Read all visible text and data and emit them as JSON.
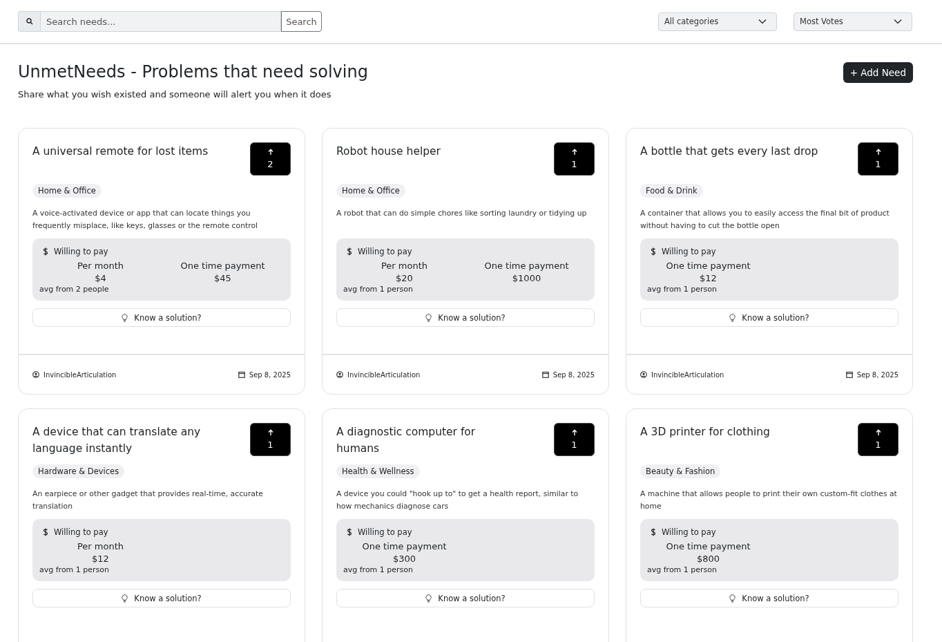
{
  "search": {
    "placeholder": "Search needs...",
    "button": "Search"
  },
  "filters": [
    {
      "value": "All categories"
    },
    {
      "value": "Most Votes"
    }
  ],
  "title": "UnmetNeeds - Problems that need solving",
  "subtitle": "Share what you wish existed and someone will alert you when it does",
  "add_button": "+ Add Need",
  "needs": [
    {
      "title": "A universal remote for lost items",
      "votes": "2",
      "category": "Home & Office",
      "description": "A voice-activated device or app that can locate things you frequently misplace, like keys, glasses or the remote control",
      "pay_label": "Willing to pay",
      "payments": [
        {
          "label": "Per month",
          "amount": "$4"
        },
        {
          "label": "One time payment",
          "amount": "$45"
        }
      ],
      "avg": "avg from 2 people",
      "solution": "Know a solution?",
      "author": "InvincibleArticulation",
      "date": "Sep 8, 2025"
    },
    {
      "title": "Robot house helper",
      "votes": "1",
      "category": "Home & Office",
      "description": "A robot that can do simple chores like sorting laundry or tidying up",
      "pay_label": "Willing to pay",
      "payments": [
        {
          "label": "Per month",
          "amount": "$20"
        },
        {
          "label": "One time payment",
          "amount": "$1000"
        }
      ],
      "avg": "avg from 1 person",
      "solution": "Know a solution?",
      "author": "InvincibleArticulation",
      "date": "Sep 8, 2025"
    },
    {
      "title": "A bottle that gets every last drop",
      "votes": "1",
      "category": "Food & Drink",
      "description": "A container that allows you to easily access the final bit of product without having to cut the bottle open",
      "pay_label": "Willing to pay",
      "payments": [
        {
          "label": "One time payment",
          "amount": "$12"
        }
      ],
      "avg": "avg from 1 person",
      "solution": "Know a solution?",
      "author": "InvincibleArticulation",
      "date": "Sep 8, 2025"
    },
    {
      "title": "A device that can translate any language instantly",
      "votes": "1",
      "category": "Hardware & Devices",
      "description": "An earpiece or other gadget that provides real-time, accurate translation",
      "pay_label": "Willing to pay",
      "payments": [
        {
          "label": "Per month",
          "amount": "$12"
        }
      ],
      "avg": "avg from 1 person",
      "solution": "Know a solution?"
    },
    {
      "title": "A diagnostic computer for humans",
      "votes": "1",
      "category": "Health & Wellness",
      "description": "A device you could \"hook up to\" to get a health report, similar to how mechanics diagnose cars",
      "pay_label": "Willing to pay",
      "payments": [
        {
          "label": "One time payment",
          "amount": "$300"
        }
      ],
      "avg": "avg from 1 person",
      "solution": "Know a solution?"
    },
    {
      "title": "A 3D printer for clothing",
      "votes": "1",
      "category": "Beauty & Fashion",
      "description": "A machine that allows people to print their own custom-fit clothes at home",
      "pay_label": "Willing to pay",
      "payments": [
        {
          "label": "One time payment",
          "amount": "$800"
        }
      ],
      "avg": "avg from 1 person",
      "solution": "Know a solution?"
    }
  ]
}
